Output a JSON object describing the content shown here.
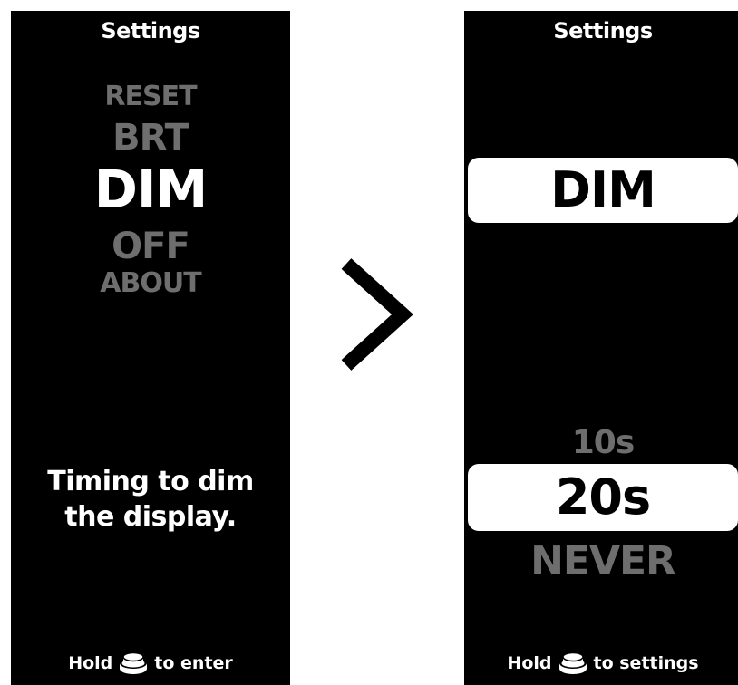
{
  "left_screen": {
    "title": "Settings",
    "menu": {
      "reset": "RESET",
      "brt": "BRT",
      "dim": "DIM",
      "off": "OFF",
      "about": "ABOUT"
    },
    "description_line1": "Timing to dim",
    "description_line2": "the display.",
    "footer": {
      "hold": "Hold",
      "action": "to enter"
    }
  },
  "right_screen": {
    "title": "Settings",
    "selected_setting": "DIM",
    "options": {
      "prev": "10s",
      "current": "20s",
      "next": "NEVER"
    },
    "footer": {
      "hold": "Hold",
      "action": "to settings"
    }
  },
  "colors": {
    "screen_bg": "#000000",
    "active_text": "#ffffff",
    "inactive_text": "#6e6e6e",
    "highlight_bg": "#ffffff"
  },
  "icons": {
    "transition": "chevron-right-icon",
    "button": "push-button-icon"
  }
}
